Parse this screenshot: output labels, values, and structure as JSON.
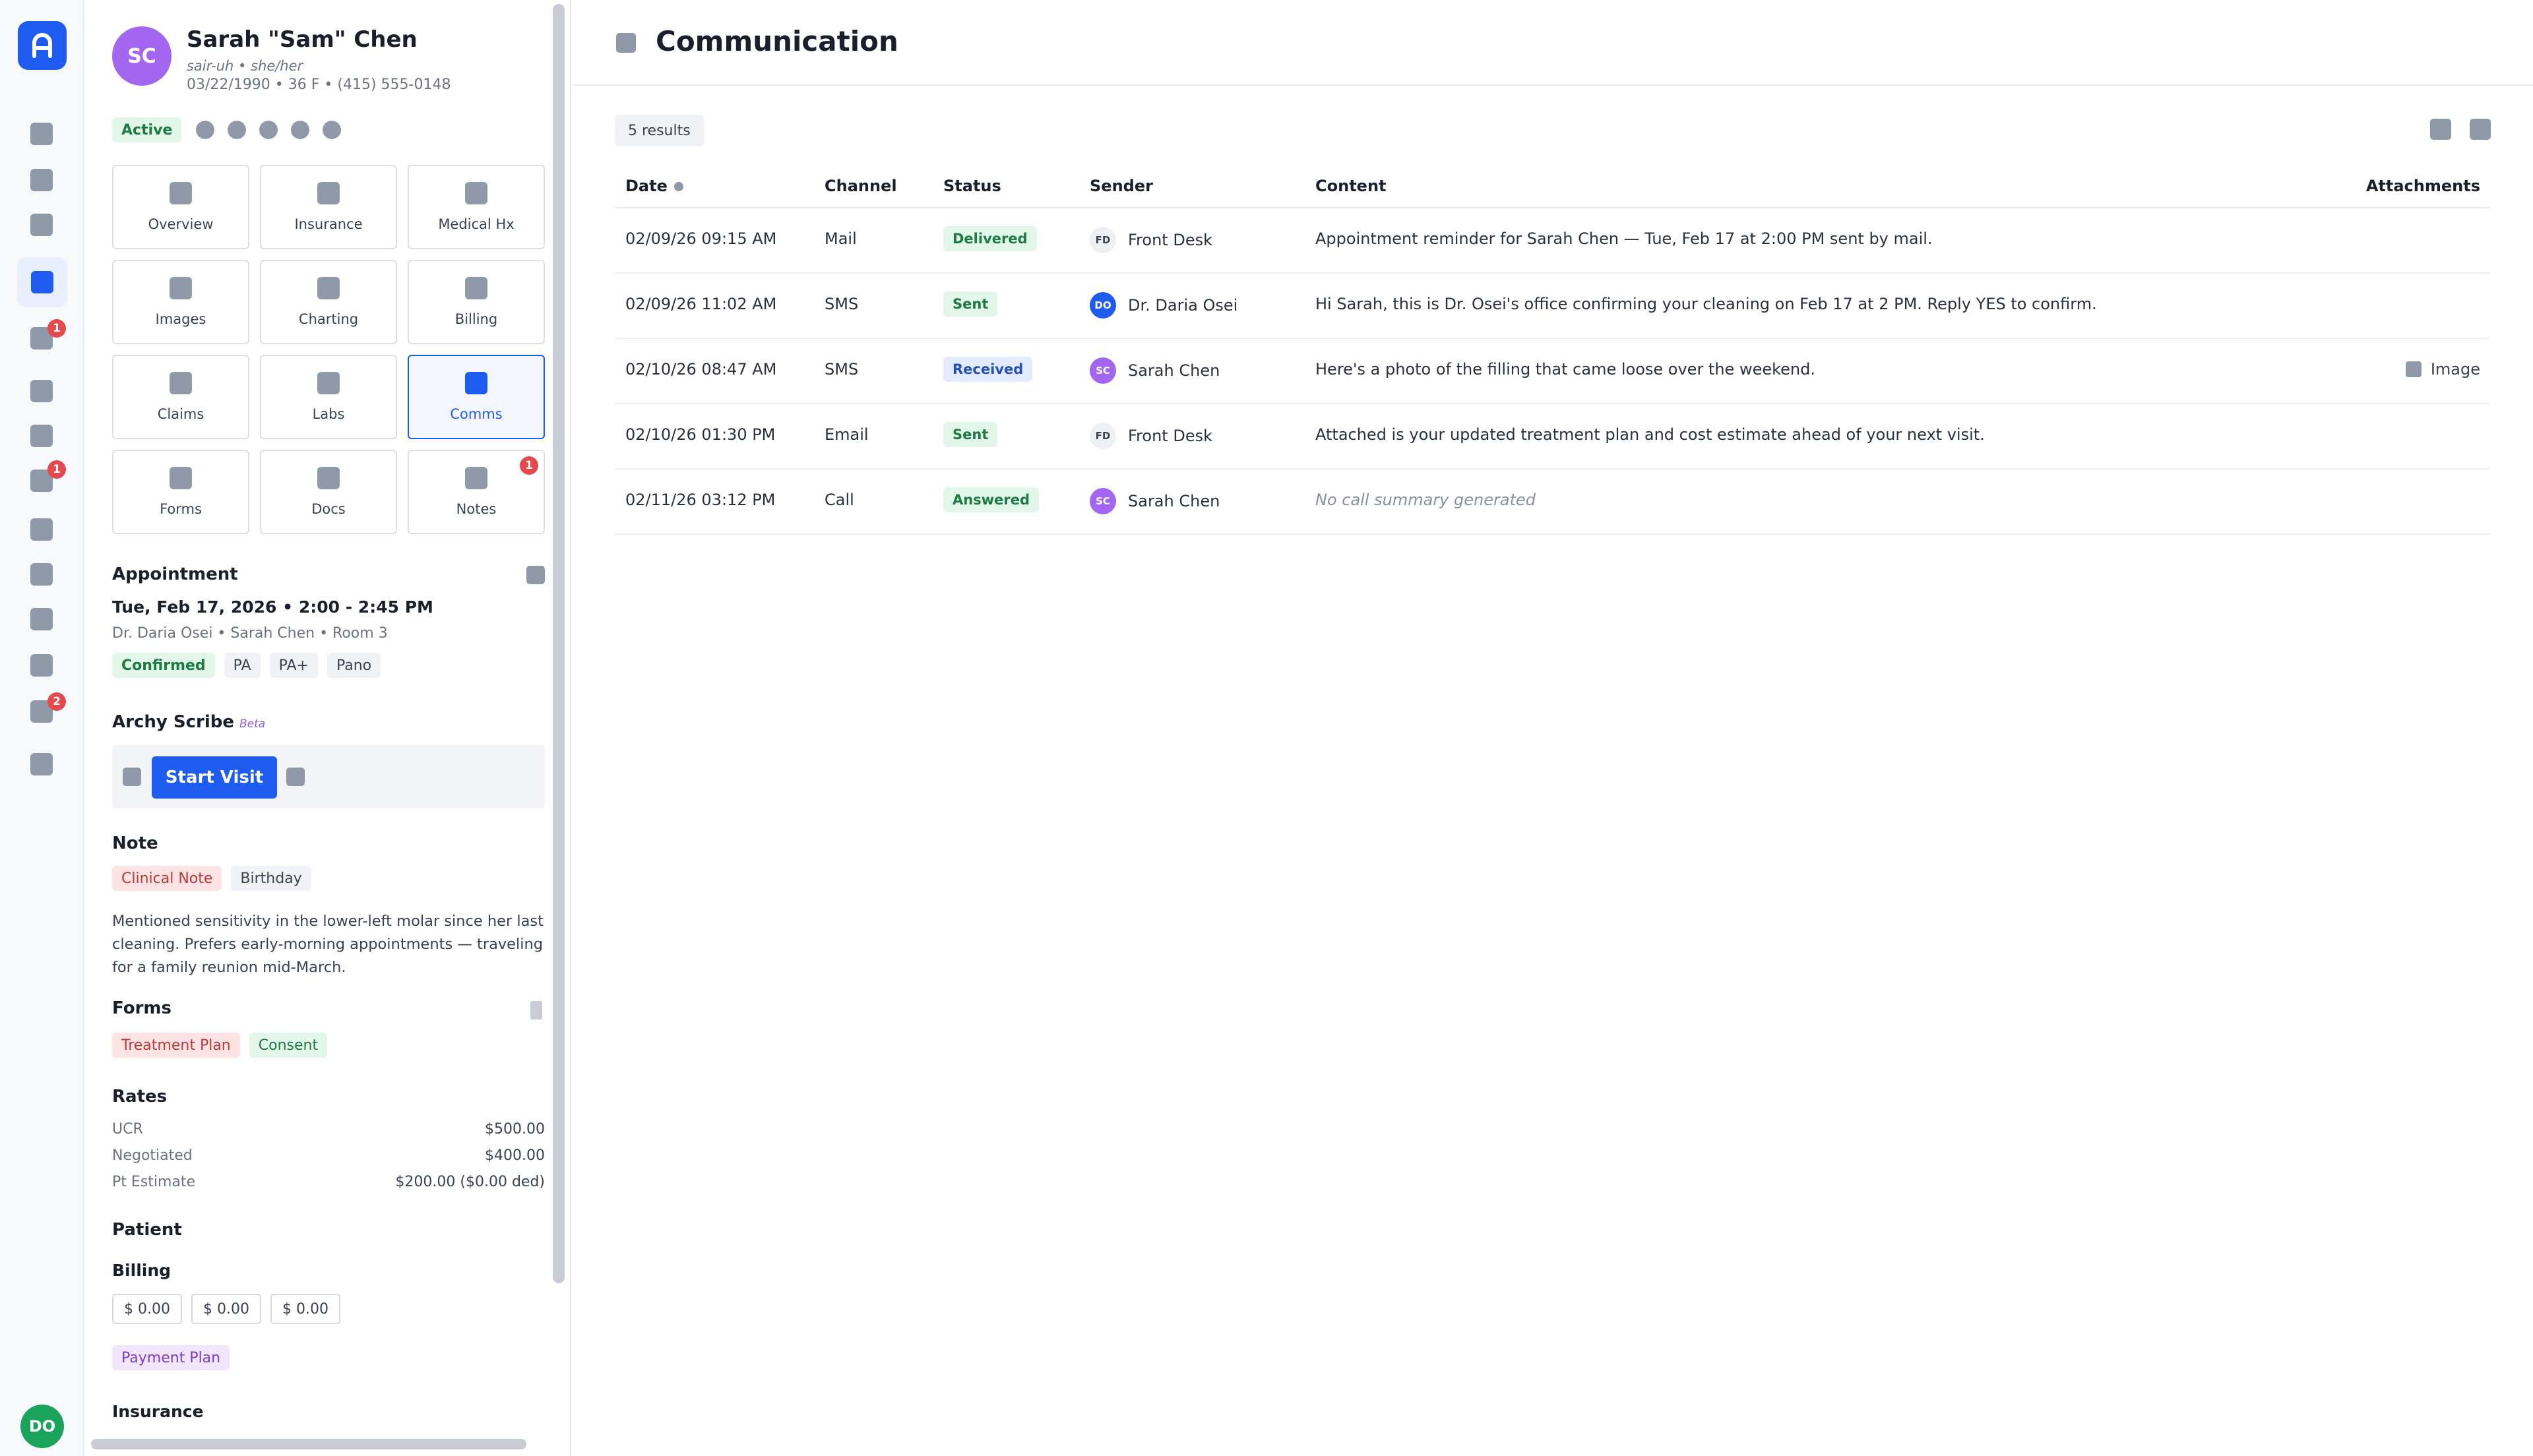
{
  "rail": {
    "badges": [
      "1",
      "1",
      "2"
    ],
    "user_initials": "DO"
  },
  "patient": {
    "initials": "SC",
    "name": "Sarah \"Sam\" Chen",
    "pronunciation": "sair-uh • she/her",
    "details": "03/22/1990 • 36 F • (415) 555-0148",
    "status": "Active"
  },
  "nav_tiles": [
    {
      "label": "Overview"
    },
    {
      "label": "Insurance"
    },
    {
      "label": "Medical Hx"
    },
    {
      "label": "Images"
    },
    {
      "label": "Charting"
    },
    {
      "label": "Billing"
    },
    {
      "label": "Claims"
    },
    {
      "label": "Labs"
    },
    {
      "label": "Comms",
      "active": true
    },
    {
      "label": "Forms"
    },
    {
      "label": "Docs"
    },
    {
      "label": "Notes",
      "badge": "1"
    }
  ],
  "appointment": {
    "heading": "Appointment",
    "date": "Tue, Feb 17, 2026 • 2:00 - 2:45 PM",
    "who": "Dr. Daria Osei • Sarah Chen • Room 3",
    "tags": [
      "Confirmed",
      "PA",
      "PA+",
      "Pano"
    ]
  },
  "scribe": {
    "heading": "Archy Scribe",
    "beta": "Beta",
    "start_label": "Start Visit"
  },
  "note": {
    "heading": "Note",
    "tags": [
      "Clinical Note",
      "Birthday"
    ],
    "text": "Mentioned sensitivity in the lower-left molar since her last cleaning. Prefers early-morning appointments — traveling for a family reunion mid-March."
  },
  "forms": {
    "heading": "Forms",
    "tags": [
      "Treatment Plan",
      "Consent"
    ]
  },
  "rates": {
    "heading": "Rates",
    "rows": [
      {
        "label": "UCR",
        "value": "$500.00"
      },
      {
        "label": "Negotiated",
        "value": "$400.00"
      },
      {
        "label": "Pt Estimate",
        "value": "$200.00 ($0.00 ded)"
      }
    ]
  },
  "patient_section": {
    "heading": "Patient",
    "billing_heading": "Billing",
    "billing_values": [
      "$ 0.00",
      "$ 0.00",
      "$ 0.00"
    ],
    "payment_plan": "Payment Plan",
    "insurance_heading": "Insurance"
  },
  "main": {
    "title": "Communication",
    "results": "5 results",
    "columns": {
      "date": "Date",
      "channel": "Channel",
      "status": "Status",
      "sender": "Sender",
      "content": "Content",
      "attachments": "Attachments"
    },
    "rows": [
      {
        "date": "02/09/26 09:15 AM",
        "channel": "Mail",
        "status": "Delivered",
        "status_color": "green",
        "sender_initials": "FD",
        "sender_type": "fd",
        "sender": "Front Desk",
        "content": "Appointment reminder for Sarah Chen — Tue, Feb 17 at 2:00 PM sent by mail.",
        "attachment": ""
      },
      {
        "date": "02/09/26 11:02 AM",
        "channel": "SMS",
        "status": "Sent",
        "status_color": "green",
        "sender_initials": "DO",
        "sender_type": "do",
        "sender": "Dr. Daria Osei",
        "content": "Hi Sarah, this is Dr. Osei's office confirming your cleaning on Feb 17 at 2 PM. Reply YES to confirm.",
        "attachment": ""
      },
      {
        "date": "02/10/26 08:47 AM",
        "channel": "SMS",
        "status": "Received",
        "status_color": "blue",
        "sender_initials": "SC",
        "sender_type": "sc",
        "sender": "Sarah Chen",
        "content": "Here's a photo of the filling that came loose over the weekend.",
        "attachment": "Image"
      },
      {
        "date": "02/10/26 01:30 PM",
        "channel": "Email",
        "status": "Sent",
        "status_color": "green",
        "sender_initials": "FD",
        "sender_type": "fd",
        "sender": "Front Desk",
        "content": "Attached is your updated treatment plan and cost estimate ahead of your next visit.",
        "attachment": ""
      },
      {
        "date": "02/11/26 03:12 PM",
        "channel": "Call",
        "status": "Answered",
        "status_color": "green",
        "sender_initials": "SC",
        "sender_type": "sc",
        "sender": "Sarah Chen",
        "content": "No call summary generated",
        "content_empty": true,
        "attachment": ""
      }
    ]
  }
}
